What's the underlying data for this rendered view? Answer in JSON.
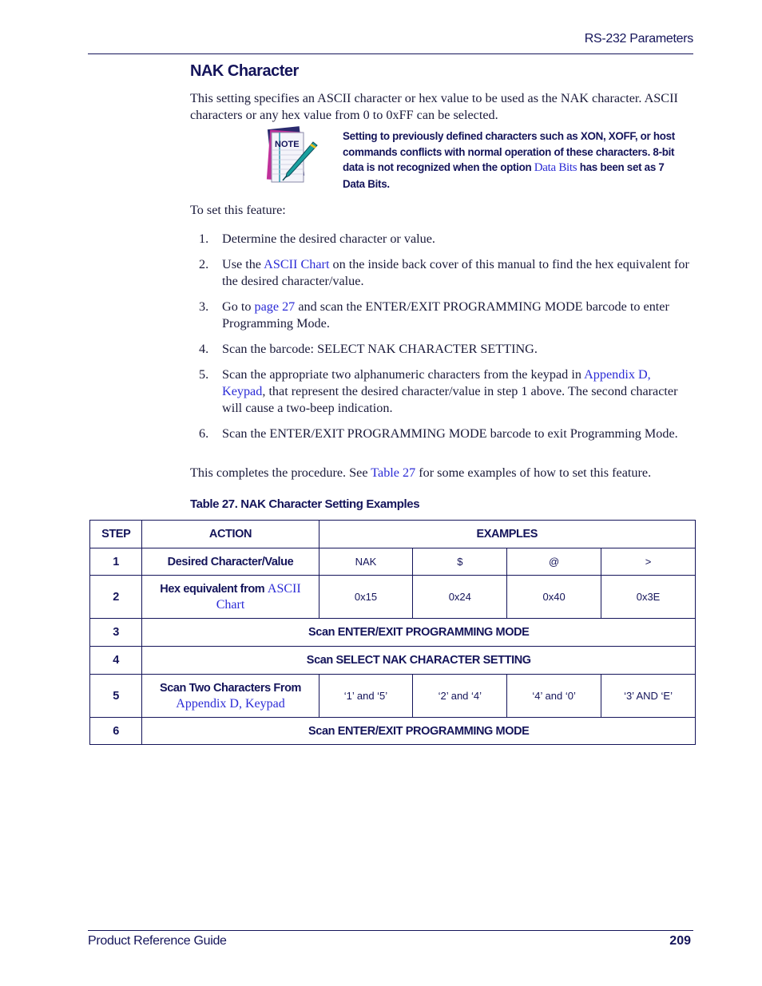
{
  "header": {
    "section": "RS-232 Parameters"
  },
  "title": "NAK Character",
  "intro": "This setting specifies an ASCII character or hex value to be used as the NAK character. ASCII characters or any hex value from 0 to 0xFF can be selected.",
  "note": {
    "icon": "note-pad-pen-icon",
    "icon_label": "NOTE",
    "text_before": "Setting to previously defined characters such as XON, XOFF, or host commands conflicts with normal operation of these characters. 8-bit data is not recognized when the option ",
    "link": "Data Bits",
    "text_after": " has been set as 7 Data Bits."
  },
  "setup_intro": "To set this feature:",
  "steps": [
    {
      "num": "1.",
      "before": "Determine the desired character or value.",
      "link": "",
      "after": "",
      "link2": "",
      "after2": ""
    },
    {
      "num": "2.",
      "before": "Use the ",
      "link": "ASCII Chart",
      "after": " on the inside back cover of this manual to find the hex equivalent for the desired character/value.",
      "link2": "",
      "after2": ""
    },
    {
      "num": "3.",
      "before": "Go to ",
      "link": "page 27",
      "after": " and scan the ENTER/EXIT PROGRAMMING MODE barcode to enter Programming Mode.",
      "link2": "",
      "after2": ""
    },
    {
      "num": "4.",
      "before": "Scan the barcode: SELECT NAK CHARACTER SETTING.",
      "link": "",
      "after": "",
      "link2": "",
      "after2": ""
    },
    {
      "num": "5.",
      "before": "Scan the appropriate two alphanumeric characters from the keypad in ",
      "link": "Appendix D, Keypad",
      "after": ", that represent the desired character/value in step 1 above. The second character will cause a two-beep indication.",
      "link2": "",
      "after2": ""
    },
    {
      "num": "6.",
      "before": "Scan the ENTER/EXIT PROGRAMMING MODE barcode to exit Programming Mode.",
      "link": "",
      "after": "",
      "link2": "",
      "after2": ""
    }
  ],
  "outro": {
    "before": "This completes the procedure. See ",
    "link": "Table 27",
    "after": " for some examples of how to set this feature."
  },
  "table": {
    "caption": "Table 27. NAK Character Setting Examples",
    "headers": {
      "step": "STEP",
      "action": "ACTION",
      "examples": "EXAMPLES"
    },
    "rows": [
      {
        "step": "1",
        "action": "Desired Character/Value",
        "action_link": "",
        "values": [
          "NAK",
          "$",
          "@",
          ">"
        ]
      },
      {
        "step": "2",
        "action": "Hex equivalent from ",
        "action_link": "ASCII Chart",
        "values": [
          "0x15",
          "0x24",
          "0x40",
          "0x3E"
        ]
      },
      {
        "step": "3",
        "span": "Scan ENTER/EXIT PROGRAMMING MODE"
      },
      {
        "step": "4",
        "span": "Scan SELECT NAK CHARACTER SETTING"
      },
      {
        "step": "5",
        "action": "Scan Two Characters From",
        "action_link": "Appendix D, Keypad",
        "values": [
          "‘1’ and ‘5’",
          "‘2’ and ‘4’",
          "‘4’ and ‘0’",
          "‘3’ AND ‘E’"
        ]
      },
      {
        "step": "6",
        "span": "Scan ENTER/EXIT PROGRAMMING MODE"
      }
    ]
  },
  "footer": {
    "guide": "Product Reference Guide",
    "page": "209"
  },
  "colors": {
    "navy": "#14145a",
    "link": "#2b2bd6",
    "body_text": "#1a1a3a"
  }
}
